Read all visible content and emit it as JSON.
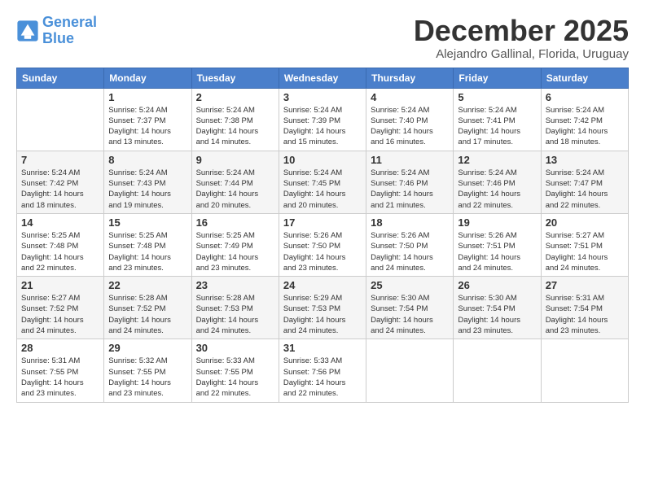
{
  "logo": {
    "line1": "General",
    "line2": "Blue"
  },
  "title": "December 2025",
  "subtitle": "Alejandro Gallinal, Florida, Uruguay",
  "weekdays": [
    "Sunday",
    "Monday",
    "Tuesday",
    "Wednesday",
    "Thursday",
    "Friday",
    "Saturday"
  ],
  "weeks": [
    [
      {
        "day": "",
        "info": ""
      },
      {
        "day": "1",
        "info": "Sunrise: 5:24 AM\nSunset: 7:37 PM\nDaylight: 14 hours\nand 13 minutes."
      },
      {
        "day": "2",
        "info": "Sunrise: 5:24 AM\nSunset: 7:38 PM\nDaylight: 14 hours\nand 14 minutes."
      },
      {
        "day": "3",
        "info": "Sunrise: 5:24 AM\nSunset: 7:39 PM\nDaylight: 14 hours\nand 15 minutes."
      },
      {
        "day": "4",
        "info": "Sunrise: 5:24 AM\nSunset: 7:40 PM\nDaylight: 14 hours\nand 16 minutes."
      },
      {
        "day": "5",
        "info": "Sunrise: 5:24 AM\nSunset: 7:41 PM\nDaylight: 14 hours\nand 17 minutes."
      },
      {
        "day": "6",
        "info": "Sunrise: 5:24 AM\nSunset: 7:42 PM\nDaylight: 14 hours\nand 18 minutes."
      }
    ],
    [
      {
        "day": "7",
        "info": "Sunrise: 5:24 AM\nSunset: 7:42 PM\nDaylight: 14 hours\nand 18 minutes."
      },
      {
        "day": "8",
        "info": "Sunrise: 5:24 AM\nSunset: 7:43 PM\nDaylight: 14 hours\nand 19 minutes."
      },
      {
        "day": "9",
        "info": "Sunrise: 5:24 AM\nSunset: 7:44 PM\nDaylight: 14 hours\nand 20 minutes."
      },
      {
        "day": "10",
        "info": "Sunrise: 5:24 AM\nSunset: 7:45 PM\nDaylight: 14 hours\nand 20 minutes."
      },
      {
        "day": "11",
        "info": "Sunrise: 5:24 AM\nSunset: 7:46 PM\nDaylight: 14 hours\nand 21 minutes."
      },
      {
        "day": "12",
        "info": "Sunrise: 5:24 AM\nSunset: 7:46 PM\nDaylight: 14 hours\nand 22 minutes."
      },
      {
        "day": "13",
        "info": "Sunrise: 5:24 AM\nSunset: 7:47 PM\nDaylight: 14 hours\nand 22 minutes."
      }
    ],
    [
      {
        "day": "14",
        "info": "Sunrise: 5:25 AM\nSunset: 7:48 PM\nDaylight: 14 hours\nand 22 minutes."
      },
      {
        "day": "15",
        "info": "Sunrise: 5:25 AM\nSunset: 7:48 PM\nDaylight: 14 hours\nand 23 minutes."
      },
      {
        "day": "16",
        "info": "Sunrise: 5:25 AM\nSunset: 7:49 PM\nDaylight: 14 hours\nand 23 minutes."
      },
      {
        "day": "17",
        "info": "Sunrise: 5:26 AM\nSunset: 7:50 PM\nDaylight: 14 hours\nand 23 minutes."
      },
      {
        "day": "18",
        "info": "Sunrise: 5:26 AM\nSunset: 7:50 PM\nDaylight: 14 hours\nand 24 minutes."
      },
      {
        "day": "19",
        "info": "Sunrise: 5:26 AM\nSunset: 7:51 PM\nDaylight: 14 hours\nand 24 minutes."
      },
      {
        "day": "20",
        "info": "Sunrise: 5:27 AM\nSunset: 7:51 PM\nDaylight: 14 hours\nand 24 minutes."
      }
    ],
    [
      {
        "day": "21",
        "info": "Sunrise: 5:27 AM\nSunset: 7:52 PM\nDaylight: 14 hours\nand 24 minutes."
      },
      {
        "day": "22",
        "info": "Sunrise: 5:28 AM\nSunset: 7:52 PM\nDaylight: 14 hours\nand 24 minutes."
      },
      {
        "day": "23",
        "info": "Sunrise: 5:28 AM\nSunset: 7:53 PM\nDaylight: 14 hours\nand 24 minutes."
      },
      {
        "day": "24",
        "info": "Sunrise: 5:29 AM\nSunset: 7:53 PM\nDaylight: 14 hours\nand 24 minutes."
      },
      {
        "day": "25",
        "info": "Sunrise: 5:30 AM\nSunset: 7:54 PM\nDaylight: 14 hours\nand 24 minutes."
      },
      {
        "day": "26",
        "info": "Sunrise: 5:30 AM\nSunset: 7:54 PM\nDaylight: 14 hours\nand 23 minutes."
      },
      {
        "day": "27",
        "info": "Sunrise: 5:31 AM\nSunset: 7:54 PM\nDaylight: 14 hours\nand 23 minutes."
      }
    ],
    [
      {
        "day": "28",
        "info": "Sunrise: 5:31 AM\nSunset: 7:55 PM\nDaylight: 14 hours\nand 23 minutes."
      },
      {
        "day": "29",
        "info": "Sunrise: 5:32 AM\nSunset: 7:55 PM\nDaylight: 14 hours\nand 23 minutes."
      },
      {
        "day": "30",
        "info": "Sunrise: 5:33 AM\nSunset: 7:55 PM\nDaylight: 14 hours\nand 22 minutes."
      },
      {
        "day": "31",
        "info": "Sunrise: 5:33 AM\nSunset: 7:56 PM\nDaylight: 14 hours\nand 22 minutes."
      },
      {
        "day": "",
        "info": ""
      },
      {
        "day": "",
        "info": ""
      },
      {
        "day": "",
        "info": ""
      }
    ]
  ]
}
